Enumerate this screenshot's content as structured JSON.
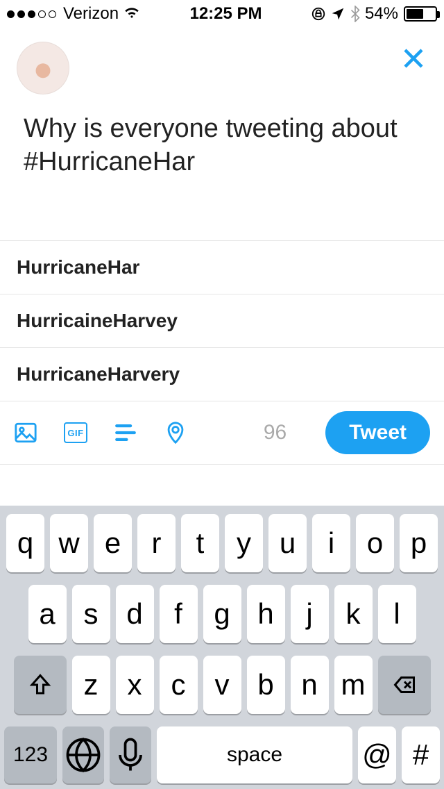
{
  "status": {
    "carrier": "Verizon",
    "time": "12:25 PM",
    "battery_pct": "54%"
  },
  "compose": {
    "text": "Why is everyone tweeting about #HurricaneHar"
  },
  "suggestions": [
    "HurricaneHar",
    "HurricaineHarvey",
    "HurricaneHarvery"
  ],
  "toolbar": {
    "gif_label": "GIF",
    "char_count": "96",
    "tweet_label": "Tweet"
  },
  "keyboard": {
    "row1": [
      "q",
      "w",
      "e",
      "r",
      "t",
      "y",
      "u",
      "i",
      "o",
      "p"
    ],
    "row2": [
      "a",
      "s",
      "d",
      "f",
      "g",
      "h",
      "j",
      "k",
      "l"
    ],
    "row3": [
      "z",
      "x",
      "c",
      "v",
      "b",
      "n",
      "m"
    ],
    "num_label": "123",
    "space_label": "space",
    "sym1": "@",
    "sym2": "#"
  }
}
